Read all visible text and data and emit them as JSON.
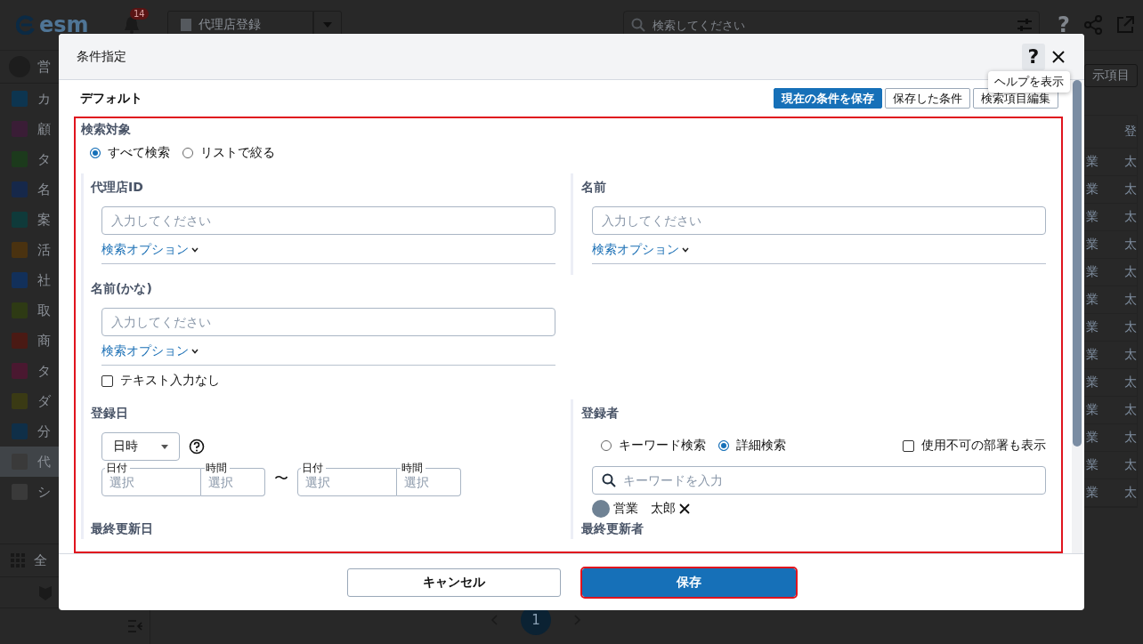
{
  "app": {
    "logo": "esm",
    "notification_count": "14",
    "module_select": "代理店登録",
    "search_placeholder": "検索してください",
    "help": "?",
    "user": "営",
    "nav": [
      {
        "label": "カ",
        "color": "#0d3550",
        "selected": false
      },
      {
        "label": "顧",
        "color": "#3a1d36",
        "selected": false
      },
      {
        "label": "タ",
        "color": "#1c3a1c",
        "selected": false
      },
      {
        "label": "名",
        "color": "#16284a",
        "selected": false
      },
      {
        "label": "案",
        "color": "#0f3a3a",
        "selected": false
      },
      {
        "label": "活",
        "color": "#4a3210",
        "selected": false
      },
      {
        "label": "社",
        "color": "#12305a",
        "selected": false
      },
      {
        "label": "取",
        "color": "#2e3a14",
        "selected": false
      },
      {
        "label": "商",
        "color": "#4a1a14",
        "selected": false
      },
      {
        "label": "タ",
        "color": "#4a1830",
        "selected": false
      },
      {
        "label": "ダ",
        "color": "#3a3a14",
        "selected": false
      },
      {
        "label": "分",
        "color": "#0f2f48",
        "selected": false
      },
      {
        "label": "代",
        "color": "#3a3a3a",
        "selected": true
      },
      {
        "label": "シ",
        "color": "#3a3a3a",
        "selected": false
      }
    ],
    "nav_all": "全",
    "view_button": "示項目",
    "table_header": "登",
    "table_rows": [
      [
        "業",
        "太"
      ],
      [
        "業",
        "太"
      ],
      [
        "業",
        "太"
      ],
      [
        "業",
        "太"
      ],
      [
        "業",
        "太"
      ],
      [
        "業",
        "太"
      ],
      [
        "業",
        "太"
      ],
      [
        "業",
        "太"
      ],
      [
        "業",
        "太"
      ],
      [
        "業",
        "太"
      ],
      [
        "業",
        "太"
      ],
      [
        "業",
        "太"
      ],
      [
        "業",
        "太"
      ]
    ],
    "current_page": "1"
  },
  "dialog": {
    "title": "条件指定",
    "help_button": "?",
    "tooltip": "ヘルプを表示",
    "preset": "デフォルト",
    "toolbar_buttons": [
      {
        "label": "現在の条件を保存",
        "kind": "primary"
      },
      {
        "label": "保存した条件",
        "kind": "outline"
      },
      {
        "label": "検索項目編集",
        "kind": "outline"
      }
    ],
    "fields_highlighted": true,
    "search_target": {
      "label": "検索対象",
      "options": [
        {
          "label": "すべて検索",
          "selected": true
        },
        {
          "label": "リストで絞る",
          "selected": false
        }
      ]
    },
    "rows": [
      [
        {
          "kind": "text",
          "label": "代理店ID",
          "placeholder": "入力してください",
          "option_link": "検索オプション"
        },
        {
          "kind": "text",
          "label": "名前",
          "placeholder": "入力してください",
          "option_link": "検索オプション"
        }
      ],
      [
        {
          "kind": "text",
          "label": "名前(かな)",
          "placeholder": "入力してください",
          "option_link": "検索オプション",
          "checkbox": {
            "label": "テキスト入力なし",
            "checked": false
          }
        }
      ],
      [
        {
          "kind": "date_range",
          "label": "登録日",
          "mode": "日時",
          "separator": "〜",
          "parts": [
            {
              "label": "日付",
              "placeholder": "選択"
            },
            {
              "label": "時間",
              "placeholder": "選択"
            },
            {
              "label": "日付",
              "placeholder": "選択"
            },
            {
              "label": "時間",
              "placeholder": "選択"
            }
          ]
        },
        {
          "kind": "user",
          "label": "登録者",
          "options": [
            {
              "label": "キーワード検索",
              "selected": false
            },
            {
              "label": "詳細検索",
              "selected": true
            }
          ],
          "checkbox": {
            "label": "使用不可の部署も表示",
            "checked": false
          },
          "search_placeholder": "キーワードを入力",
          "chips": [
            {
              "name": "営業　太郎"
            }
          ]
        }
      ],
      [
        {
          "kind": "cut",
          "label": "最終更新日"
        },
        {
          "kind": "cut",
          "label": "最終更新者"
        }
      ]
    ],
    "footer_buttons": [
      {
        "label": "キャンセル",
        "kind": "outline",
        "highlighted": false
      },
      {
        "label": "保存",
        "kind": "primary",
        "highlighted": true
      }
    ]
  }
}
